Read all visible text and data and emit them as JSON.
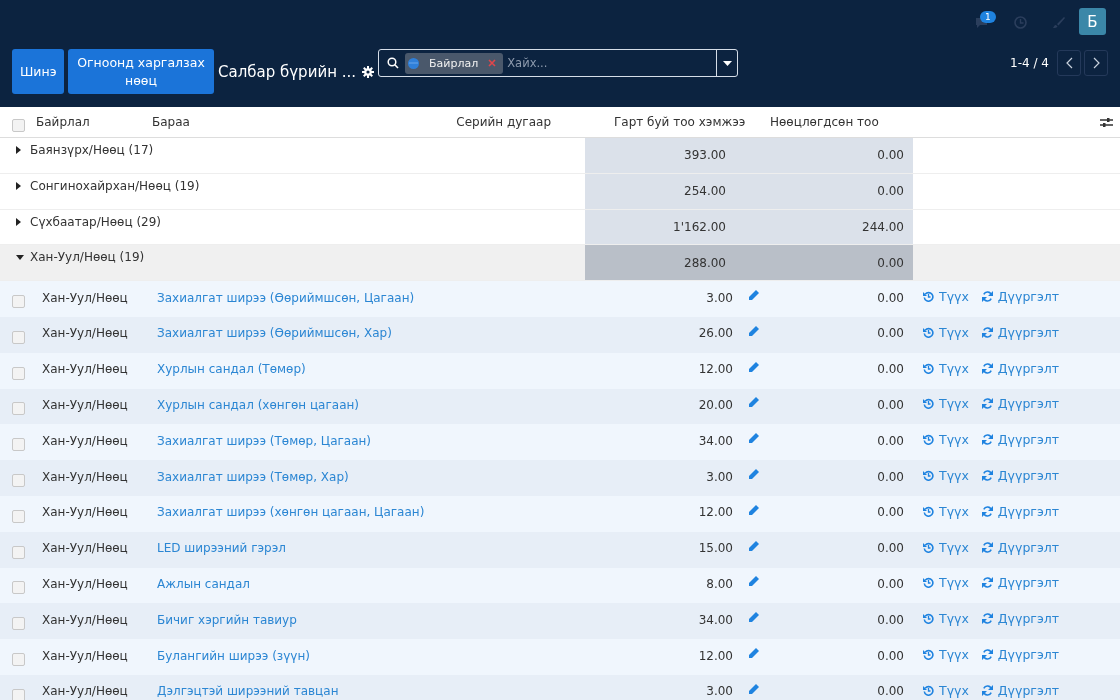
{
  "header": {
    "notifications": {
      "count": "1"
    },
    "avatar": "Б"
  },
  "toolbar": {
    "buttons": [
      "Шинэ",
      "Огноонд харгалзах нөөц"
    ],
    "title": "Салбар бүрийн ...",
    "search": {
      "facets": [
        {
          "label": "Байрлал"
        }
      ],
      "placeholder": "Хайх..."
    },
    "pager": "1-4 / 4"
  },
  "table": {
    "columns": [
      "Байрлал",
      "Бараа",
      "Серийн дугаар",
      "Гарт буй тоо хэмжээ",
      "Нөөцлөгдсөн тоо"
    ],
    "select_all": {
      "checked": false
    },
    "groups": [
      {
        "label": "Баянзүрх/Нөөц (17)",
        "expanded": false,
        "on_hand": "393.00",
        "reserved": "0.00"
      },
      {
        "label": "Сонгинохайрхан/Нөөц (19)",
        "expanded": false,
        "on_hand": "254.00",
        "reserved": "0.00"
      },
      {
        "label": "Сүхбаатар/Нөөц (29)",
        "expanded": false,
        "on_hand": "1'162.00",
        "reserved": "244.00"
      },
      {
        "label": "Хан-Уул/Нөөц (19)",
        "expanded": true,
        "on_hand": "288.00",
        "reserved": "0.00",
        "rows": [
          {
            "location": "Хан-Уул/Нөөц",
            "product": "Захиалгат ширээ (Өөриймшсөн, Цагаан)",
            "on_hand": "3.00",
            "reserved": "0.00",
            "checked": false,
            "actions": [
              "Түүх",
              "Дүүргэлт"
            ]
          },
          {
            "location": "Хан-Уул/Нөөц",
            "product": "Захиалгат ширээ (Өөриймшсөн, Хар)",
            "on_hand": "26.00",
            "reserved": "0.00",
            "checked": false,
            "actions": [
              "Түүх",
              "Дүүргэлт"
            ]
          },
          {
            "location": "Хан-Уул/Нөөц",
            "product": "Хурлын сандал (Төмөр)",
            "on_hand": "12.00",
            "reserved": "0.00",
            "checked": false,
            "actions": [
              "Түүх",
              "Дүүргэлт"
            ]
          },
          {
            "location": "Хан-Уул/Нөөц",
            "product": "Хурлын сандал (хөнгөн цагаан)",
            "on_hand": "20.00",
            "reserved": "0.00",
            "checked": false,
            "actions": [
              "Түүх",
              "Дүүргэлт"
            ]
          },
          {
            "location": "Хан-Уул/Нөөц",
            "product": "Захиалгат ширээ (Төмөр, Цагаан)",
            "on_hand": "34.00",
            "reserved": "0.00",
            "checked": false,
            "actions": [
              "Түүх",
              "Дүүргэлт"
            ]
          },
          {
            "location": "Хан-Уул/Нөөц",
            "product": "Захиалгат ширээ (Төмөр, Хар)",
            "on_hand": "3.00",
            "reserved": "0.00",
            "checked": false,
            "actions": [
              "Түүх",
              "Дүүргэлт"
            ]
          },
          {
            "location": "Хан-Уул/Нөөц",
            "product": "Захиалгат ширээ (хөнгөн цагаан, Цагаан)",
            "on_hand": "12.00",
            "reserved": "0.00",
            "checked": false,
            "actions": [
              "Түүх",
              "Дүүргэлт"
            ]
          },
          {
            "location": "Хан-Уул/Нөөц",
            "product": "LED ширээний гэрэл",
            "on_hand": "15.00",
            "reserved": "0.00",
            "checked": false,
            "actions": [
              "Түүх",
              "Дүүргэлт"
            ]
          },
          {
            "location": "Хан-Уул/Нөөц",
            "product": "Ажлын сандал",
            "on_hand": "8.00",
            "reserved": "0.00",
            "checked": false,
            "actions": [
              "Түүх",
              "Дүүргэлт"
            ]
          },
          {
            "location": "Хан-Уул/Нөөц",
            "product": "Бичиг хэргийн тавиур",
            "on_hand": "34.00",
            "reserved": "0.00",
            "checked": false,
            "actions": [
              "Түүх",
              "Дүүргэлт"
            ]
          },
          {
            "location": "Хан-Уул/Нөөц",
            "product": "Булангийн ширээ (зүүн)",
            "on_hand": "12.00",
            "reserved": "0.00",
            "checked": false,
            "actions": [
              "Түүх",
              "Дүүргэлт"
            ]
          },
          {
            "location": "Хан-Уул/Нөөц",
            "product": "Дэлгэцтэй ширээний тавцан",
            "on_hand": "3.00",
            "reserved": "0.00",
            "checked": false,
            "actions": [
              "Түүх",
              "Дүүргэлт"
            ]
          }
        ]
      }
    ]
  }
}
